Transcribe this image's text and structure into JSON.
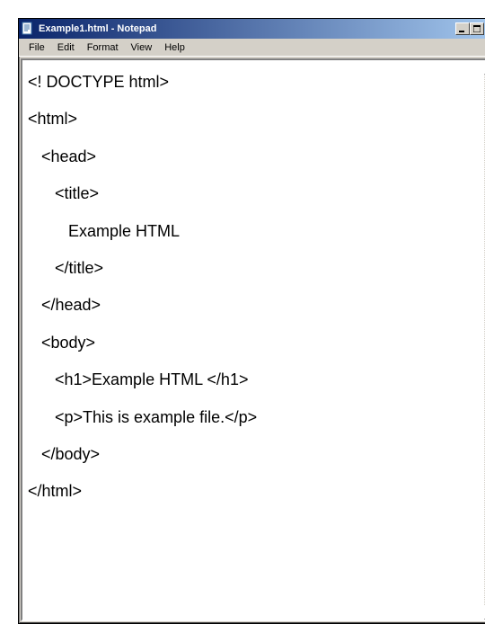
{
  "window": {
    "title": "Example1.html - Notepad"
  },
  "menu": {
    "file": "File",
    "edit": "Edit",
    "format": "Format",
    "view": "View",
    "help": "Help"
  },
  "editor": {
    "content": "<! DOCTYPE html>\n<html>\n   <head>\n      <title>\n         Example HTML\n      </title>\n   </head>\n   <body>\n      <h1>Example HTML </h1>\n      <p>This is example file.</p>\n   </body>\n</html>"
  }
}
